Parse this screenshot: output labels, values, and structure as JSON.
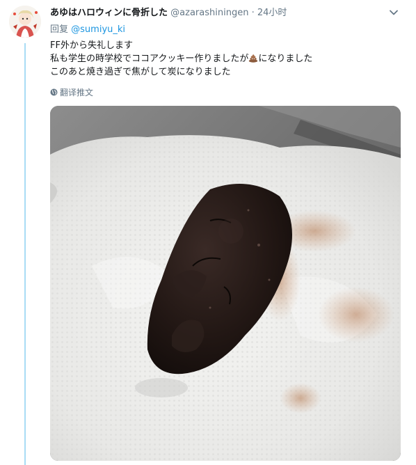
{
  "tweet": {
    "display_name": "あゆはハロウィンに骨折した",
    "handle": "@azarashiningen",
    "separator": "·",
    "time": "24小时",
    "reply_prefix": "回复",
    "reply_to": "@sumiyu_ki",
    "text_lines": [
      "FF外から失礼します",
      "私も学生の時学校でココアクッキー作りましたが",
      "このあと焼き過ぎで焦がして炭になりました"
    ],
    "text_line2_suffix": "になりました",
    "translate_label": "翻译推文"
  },
  "icons": {
    "caret": "chevron-down-icon",
    "emoji": "poop-emoji-icon",
    "globe": "globe-icon"
  },
  "colors": {
    "link": "#1b95e0",
    "secondary_text": "#657786",
    "thread_line": "#a8dcf5"
  }
}
